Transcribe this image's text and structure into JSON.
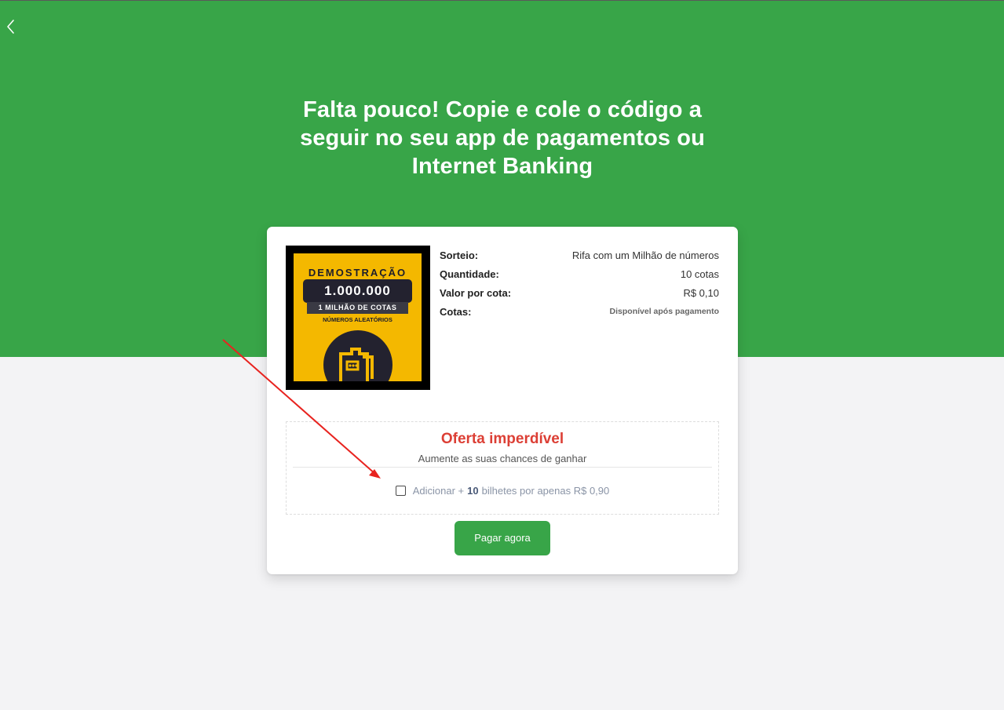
{
  "header": {
    "title": "Falta pouco! Copie e cole o código a seguir no seu app de pagamentos ou Internet Banking"
  },
  "product_image": {
    "title": "DEMOSTRAÇÃO",
    "big_number": "1.000.000",
    "subtitle": "1 MILHÃO DE COTAS",
    "subtitle2": "NÚMEROS ALEATÓRIOS"
  },
  "details": [
    {
      "label": "Sorteio:",
      "value": "Rifa com um Milhão de números"
    },
    {
      "label": "Quantidade:",
      "value": "10 cotas"
    },
    {
      "label": "Valor por cota:",
      "value": "R$ 0,10"
    },
    {
      "label": "Cotas:",
      "value": "Disponível após pagamento"
    }
  ],
  "offer": {
    "title": "Oferta imperdível",
    "subtitle": "Aumente as suas chances de ganhar",
    "prefix": "Adicionar +",
    "count": "10",
    "suffix": "bilhetes por apenas R$ 0,90"
  },
  "pay_button": "Pagar agora",
  "colors": {
    "brand_green": "#38a548",
    "offer_red": "#dc3f35",
    "annotation_arrow": "#e8231f"
  },
  "icons": {
    "back": "chevron-left-icon",
    "ticket": "ticket-icon"
  }
}
